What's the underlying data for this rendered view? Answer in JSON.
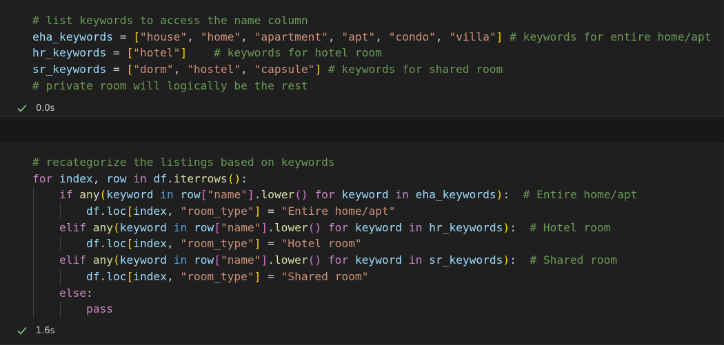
{
  "cell1": {
    "lines": [
      [
        {
          "c": "cm",
          "t": "# list keywords to access the name column"
        }
      ],
      [
        {
          "c": "var",
          "t": "eha_keywords"
        },
        {
          "c": "op",
          "t": " = "
        },
        {
          "c": "br1",
          "t": "["
        },
        {
          "c": "str",
          "t": "\"house\""
        },
        {
          "c": "op",
          "t": ", "
        },
        {
          "c": "str",
          "t": "\"home\""
        },
        {
          "c": "op",
          "t": ", "
        },
        {
          "c": "str",
          "t": "\"apartment\""
        },
        {
          "c": "op",
          "t": ", "
        },
        {
          "c": "str",
          "t": "\"apt\""
        },
        {
          "c": "op",
          "t": ", "
        },
        {
          "c": "str",
          "t": "\"condo\""
        },
        {
          "c": "op",
          "t": ", "
        },
        {
          "c": "str",
          "t": "\"villa\""
        },
        {
          "c": "br1",
          "t": "]"
        },
        {
          "c": "op",
          "t": " "
        },
        {
          "c": "cm",
          "t": "# keywords for entire home/apt"
        }
      ],
      [
        {
          "c": "var",
          "t": "hr_keywords"
        },
        {
          "c": "op",
          "t": " = "
        },
        {
          "c": "br1",
          "t": "["
        },
        {
          "c": "str",
          "t": "\"hotel\""
        },
        {
          "c": "br1",
          "t": "]"
        },
        {
          "c": "op",
          "t": "    "
        },
        {
          "c": "cm",
          "t": "# keywords for hotel room"
        }
      ],
      [
        {
          "c": "var",
          "t": "sr_keywords"
        },
        {
          "c": "op",
          "t": " = "
        },
        {
          "c": "br1",
          "t": "["
        },
        {
          "c": "str",
          "t": "\"dorm\""
        },
        {
          "c": "op",
          "t": ", "
        },
        {
          "c": "str",
          "t": "\"hostel\""
        },
        {
          "c": "op",
          "t": ", "
        },
        {
          "c": "str",
          "t": "\"capsule\""
        },
        {
          "c": "br1",
          "t": "]"
        },
        {
          "c": "op",
          "t": " "
        },
        {
          "c": "cm",
          "t": "# keywords for shared room"
        }
      ],
      [
        {
          "c": "cm",
          "t": "# private room will logically be the rest"
        }
      ]
    ],
    "exec_time": "0.0s"
  },
  "cell2": {
    "lines": [
      [
        {
          "c": "cm",
          "t": "# recategorize the listings based on keywords"
        }
      ],
      [
        {
          "c": "kw",
          "t": "for"
        },
        {
          "c": "op",
          "t": " "
        },
        {
          "c": "var",
          "t": "index"
        },
        {
          "c": "op",
          "t": ", "
        },
        {
          "c": "var",
          "t": "row"
        },
        {
          "c": "op",
          "t": " "
        },
        {
          "c": "kw",
          "t": "in"
        },
        {
          "c": "op",
          "t": " "
        },
        {
          "c": "var",
          "t": "df"
        },
        {
          "c": "op",
          "t": "."
        },
        {
          "c": "fn",
          "t": "iterrows"
        },
        {
          "c": "br1",
          "t": "()"
        },
        {
          "c": "op",
          "t": ":"
        }
      ],
      [
        {
          "c": "op",
          "t": "    "
        },
        {
          "c": "kw",
          "t": "if"
        },
        {
          "c": "op",
          "t": " "
        },
        {
          "c": "fn",
          "t": "any"
        },
        {
          "c": "br1",
          "t": "("
        },
        {
          "c": "var",
          "t": "keyword"
        },
        {
          "c": "op",
          "t": " "
        },
        {
          "c": "kwb",
          "t": "in"
        },
        {
          "c": "op",
          "t": " "
        },
        {
          "c": "var",
          "t": "row"
        },
        {
          "c": "br2",
          "t": "["
        },
        {
          "c": "str",
          "t": "\"name\""
        },
        {
          "c": "br2",
          "t": "]"
        },
        {
          "c": "op",
          "t": "."
        },
        {
          "c": "fn",
          "t": "lower"
        },
        {
          "c": "br2",
          "t": "()"
        },
        {
          "c": "op",
          "t": " "
        },
        {
          "c": "kw",
          "t": "for"
        },
        {
          "c": "op",
          "t": " "
        },
        {
          "c": "var",
          "t": "keyword"
        },
        {
          "c": "op",
          "t": " "
        },
        {
          "c": "kw",
          "t": "in"
        },
        {
          "c": "op",
          "t": " "
        },
        {
          "c": "var",
          "t": "eha_keywords"
        },
        {
          "c": "br1",
          "t": ")"
        },
        {
          "c": "op",
          "t": ":  "
        },
        {
          "c": "cm",
          "t": "# Entire home/apt"
        }
      ],
      [
        {
          "c": "op",
          "t": "        "
        },
        {
          "c": "var",
          "t": "df"
        },
        {
          "c": "op",
          "t": "."
        },
        {
          "c": "var",
          "t": "loc"
        },
        {
          "c": "br1",
          "t": "["
        },
        {
          "c": "var",
          "t": "index"
        },
        {
          "c": "op",
          "t": ", "
        },
        {
          "c": "str",
          "t": "\"room_type\""
        },
        {
          "c": "br1",
          "t": "]"
        },
        {
          "c": "op",
          "t": " = "
        },
        {
          "c": "str",
          "t": "\"Entire home/apt\""
        }
      ],
      [
        {
          "c": "op",
          "t": "    "
        },
        {
          "c": "kw",
          "t": "elif"
        },
        {
          "c": "op",
          "t": " "
        },
        {
          "c": "fn",
          "t": "any"
        },
        {
          "c": "br1",
          "t": "("
        },
        {
          "c": "var",
          "t": "keyword"
        },
        {
          "c": "op",
          "t": " "
        },
        {
          "c": "kwb",
          "t": "in"
        },
        {
          "c": "op",
          "t": " "
        },
        {
          "c": "var",
          "t": "row"
        },
        {
          "c": "br2",
          "t": "["
        },
        {
          "c": "str",
          "t": "\"name\""
        },
        {
          "c": "br2",
          "t": "]"
        },
        {
          "c": "op",
          "t": "."
        },
        {
          "c": "fn",
          "t": "lower"
        },
        {
          "c": "br2",
          "t": "()"
        },
        {
          "c": "op",
          "t": " "
        },
        {
          "c": "kw",
          "t": "for"
        },
        {
          "c": "op",
          "t": " "
        },
        {
          "c": "var",
          "t": "keyword"
        },
        {
          "c": "op",
          "t": " "
        },
        {
          "c": "kw",
          "t": "in"
        },
        {
          "c": "op",
          "t": " "
        },
        {
          "c": "var",
          "t": "hr_keywords"
        },
        {
          "c": "br1",
          "t": ")"
        },
        {
          "c": "op",
          "t": ":  "
        },
        {
          "c": "cm",
          "t": "# Hotel room"
        }
      ],
      [
        {
          "c": "op",
          "t": "        "
        },
        {
          "c": "var",
          "t": "df"
        },
        {
          "c": "op",
          "t": "."
        },
        {
          "c": "var",
          "t": "loc"
        },
        {
          "c": "br1",
          "t": "["
        },
        {
          "c": "var",
          "t": "index"
        },
        {
          "c": "op",
          "t": ", "
        },
        {
          "c": "str",
          "t": "\"room_type\""
        },
        {
          "c": "br1",
          "t": "]"
        },
        {
          "c": "op",
          "t": " = "
        },
        {
          "c": "str",
          "t": "\"Hotel room\""
        }
      ],
      [
        {
          "c": "op",
          "t": "    "
        },
        {
          "c": "kw",
          "t": "elif"
        },
        {
          "c": "op",
          "t": " "
        },
        {
          "c": "fn",
          "t": "any"
        },
        {
          "c": "br1",
          "t": "("
        },
        {
          "c": "var",
          "t": "keyword"
        },
        {
          "c": "op",
          "t": " "
        },
        {
          "c": "kwb",
          "t": "in"
        },
        {
          "c": "op",
          "t": " "
        },
        {
          "c": "var",
          "t": "row"
        },
        {
          "c": "br2",
          "t": "["
        },
        {
          "c": "str",
          "t": "\"name\""
        },
        {
          "c": "br2",
          "t": "]"
        },
        {
          "c": "op",
          "t": "."
        },
        {
          "c": "fn",
          "t": "lower"
        },
        {
          "c": "br2",
          "t": "()"
        },
        {
          "c": "op",
          "t": " "
        },
        {
          "c": "kw",
          "t": "for"
        },
        {
          "c": "op",
          "t": " "
        },
        {
          "c": "var",
          "t": "keyword"
        },
        {
          "c": "op",
          "t": " "
        },
        {
          "c": "kw",
          "t": "in"
        },
        {
          "c": "op",
          "t": " "
        },
        {
          "c": "var",
          "t": "sr_keywords"
        },
        {
          "c": "br1",
          "t": ")"
        },
        {
          "c": "op",
          "t": ":  "
        },
        {
          "c": "cm",
          "t": "# Shared room"
        }
      ],
      [
        {
          "c": "op",
          "t": "        "
        },
        {
          "c": "var",
          "t": "df"
        },
        {
          "c": "op",
          "t": "."
        },
        {
          "c": "var",
          "t": "loc"
        },
        {
          "c": "br1",
          "t": "["
        },
        {
          "c": "var",
          "t": "index"
        },
        {
          "c": "op",
          "t": ", "
        },
        {
          "c": "str",
          "t": "\"room_type\""
        },
        {
          "c": "br1",
          "t": "]"
        },
        {
          "c": "op",
          "t": " = "
        },
        {
          "c": "str",
          "t": "\"Shared room\""
        }
      ],
      [
        {
          "c": "op",
          "t": "    "
        },
        {
          "c": "kw",
          "t": "else"
        },
        {
          "c": "op",
          "t": ":"
        }
      ],
      [
        {
          "c": "op",
          "t": "        "
        },
        {
          "c": "kw",
          "t": "pass"
        }
      ]
    ],
    "exec_time": "1.6s"
  },
  "colors": {
    "success_check": "#89d185",
    "background": "#1f1f1f"
  }
}
